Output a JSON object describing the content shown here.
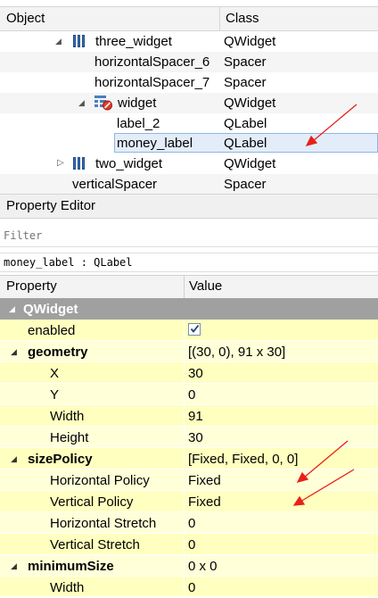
{
  "object_inspector": {
    "columns": {
      "object": "Object",
      "class": "Class"
    },
    "rows": [
      {
        "name": "three_widget",
        "class": "QWidget"
      },
      {
        "name": "horizontalSpacer_6",
        "class": "Spacer"
      },
      {
        "name": "horizontalSpacer_7",
        "class": "Spacer"
      },
      {
        "name": "widget",
        "class": "QWidget"
      },
      {
        "name": "label_2",
        "class": "QLabel"
      },
      {
        "name": "money_label",
        "class": "QLabel"
      },
      {
        "name": "two_widget",
        "class": "QWidget"
      },
      {
        "name": "verticalSpacer",
        "class": "Spacer"
      }
    ]
  },
  "property_editor": {
    "title": "Property Editor",
    "filter_placeholder": "Filter",
    "object_line": "money_label : QLabel",
    "columns": {
      "property": "Property",
      "value": "Value"
    },
    "category": "QWidget",
    "rows": [
      {
        "name": "enabled",
        "value": ""
      },
      {
        "name": "geometry",
        "value": "[(30, 0), 91 x 30]"
      },
      {
        "name": "X",
        "value": "30"
      },
      {
        "name": "Y",
        "value": "0"
      },
      {
        "name": "Width",
        "value": "91"
      },
      {
        "name": "Height",
        "value": "30"
      },
      {
        "name": "sizePolicy",
        "value": "[Fixed, Fixed, 0, 0]"
      },
      {
        "name": "Horizontal Policy",
        "value": "Fixed"
      },
      {
        "name": "Vertical Policy",
        "value": "Fixed"
      },
      {
        "name": "Horizontal Stretch",
        "value": "0"
      },
      {
        "name": "Vertical Stretch",
        "value": "0"
      },
      {
        "name": "minimumSize",
        "value": "0 x 0"
      },
      {
        "name": "Width",
        "value": "0"
      }
    ],
    "enabled_checked": true
  },
  "icons": [
    "layout-bars-icon",
    "widget-broken-layout-icon",
    "expand-triangle-icon",
    "collapse-triangle-icon",
    "checkbox-checked-icon",
    "annotation-arrow-icon"
  ],
  "colors": {
    "row_yellow": "#ffffbf",
    "row_yellow_alt": "#ffffd8",
    "category_gray": "#a0a0a0",
    "selection": "#e3edf9",
    "annotation_red": "#e8201a"
  }
}
